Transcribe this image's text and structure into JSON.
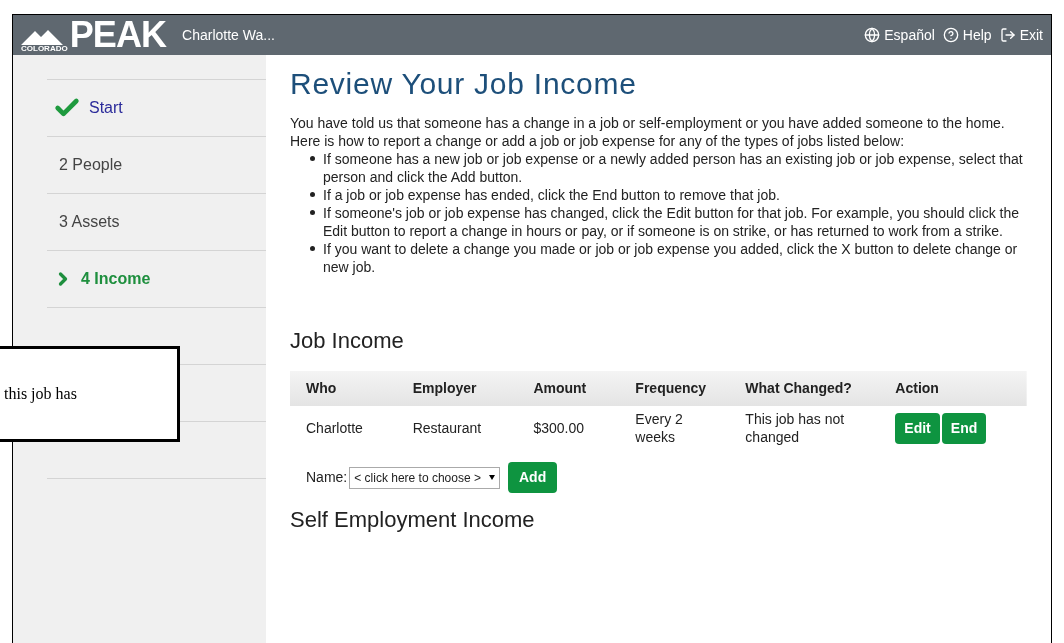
{
  "header": {
    "logo_small": "COLORADO",
    "logo": "PEAK",
    "user": "Charlotte Wa...",
    "links": [
      {
        "kind": "language",
        "label": "Español"
      },
      {
        "kind": "help",
        "label": "Help"
      },
      {
        "kind": "exit",
        "label": "Exit"
      }
    ]
  },
  "sidebar": {
    "items": [
      {
        "kind": "done",
        "label": "Start",
        "selected": false
      },
      {
        "kind": "step",
        "number": "2",
        "label": "People",
        "selected": false
      },
      {
        "kind": "step",
        "number": "3",
        "label": "Assets",
        "selected": false
      },
      {
        "kind": "step",
        "number": "4",
        "label": "Income",
        "selected": true
      },
      {
        "kind": "hidden"
      },
      {
        "kind": "hidden"
      },
      {
        "kind": "hidden"
      }
    ]
  },
  "title": "Review Your Job Income",
  "intro": "You have told us that someone has a change in a job or self-employment or you have added someone to the home. Here is how to report a change or add a job or job expense for any of the types of jobs listed below:",
  "bullets": [
    "If someone has a new job or job expense or a newly added person has an existing job or job expense, select that person and click the Add button.",
    "If a job or job expense has ended, click the End button to remove that job.",
    "If someone's job or job expense has changed, click the Edit button for that job. For example, you should click the Edit button to report a change in hours or pay, or if someone is on strike, or has returned to work from a strike.",
    "If you want to delete a change you made or job or job expense you added, click the X button to delete change or new job."
  ],
  "job_income": {
    "heading": "Job Income",
    "columns": [
      "Who",
      "Employer",
      "Amount",
      "Frequency",
      "What Changed?",
      "Action"
    ],
    "rows": [
      {
        "who": "Charlotte",
        "employer": "Restaurant",
        "amount": "$300.00",
        "frequency": "Every 2 weeks",
        "changed": "This job has not changed",
        "actions": [
          "Edit",
          "End"
        ]
      }
    ],
    "name_label": "Name:",
    "select": "< click here to choose >",
    "add": "Add"
  },
  "next_heading": "Self Employment Income",
  "callout": "this job has"
}
